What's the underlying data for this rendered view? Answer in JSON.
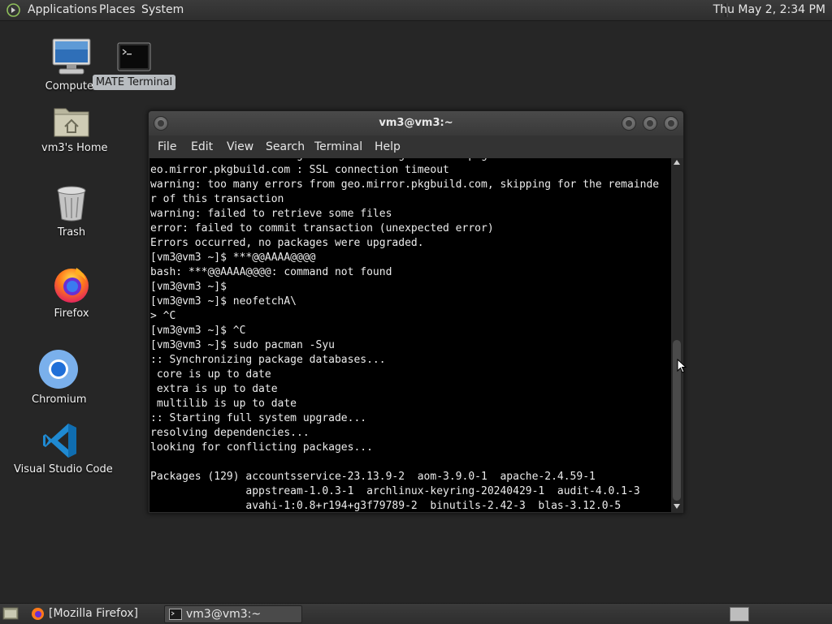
{
  "top_panel": {
    "menus": [
      "Applications",
      "Places",
      "System"
    ],
    "clock": "Thu May  2,  2:34 PM"
  },
  "desktop": {
    "icons": [
      {
        "label": "Computer",
        "icon": "computer-icon"
      },
      {
        "label": "MATE Terminal",
        "icon": "terminal-icon"
      },
      {
        "label": "vm3's Home",
        "icon": "home-folder-icon"
      },
      {
        "label": "Trash",
        "icon": "trash-icon"
      },
      {
        "label": "Firefox",
        "icon": "firefox-icon"
      },
      {
        "label": "Chromium",
        "icon": "chromium-icon"
      },
      {
        "label": "Visual Studio Code",
        "icon": "vscode-icon"
      }
    ]
  },
  "terminal": {
    "title": "vm3@vm3:~",
    "menu": [
      "File",
      "Edit",
      "View",
      "Search",
      "Terminal",
      "Help"
    ],
    "output": "error: failed retrieving file 'x' from geo.mirror.pkgbuild.com : SSL connec\neo.mirror.pkgbuild.com : SSL connection timeout\nwarning: too many errors from geo.mirror.pkgbuild.com, skipping for the remainde\nr of this transaction\nwarning: failed to retrieve some files\nerror: failed to commit transaction (unexpected error)\nErrors occurred, no packages were upgraded.\n[vm3@vm3 ~]$ ***@@AAAA@@@@\nbash: ***@@AAAA@@@@: command not found\n[vm3@vm3 ~]$\n[vm3@vm3 ~]$ neofetchA\\\n> ^C\n[vm3@vm3 ~]$ ^C\n[vm3@vm3 ~]$ sudo pacman -Syu\n:: Synchronizing package databases...\n core is up to date\n extra is up to date\n multilib is up to date\n:: Starting full system upgrade...\nresolving dependencies...\nlooking for conflicting packages...\n\nPackages (129) accountsservice-23.13.9-2  aom-3.9.0-1  apache-2.4.59-1\n               appstream-1.0.3-1  archlinux-keyring-20240429-1  audit-4.0.1-3\n               avahi-1:0.8+r194+g3f79789-2  binutils-2.42-3  blas-3.12.0-5"
  },
  "taskbar": {
    "tasks": [
      {
        "label": "[Mozilla Firefox]",
        "icon": "firefox-icon"
      },
      {
        "label": "vm3@vm3:~",
        "icon": "terminal-icon"
      }
    ]
  }
}
